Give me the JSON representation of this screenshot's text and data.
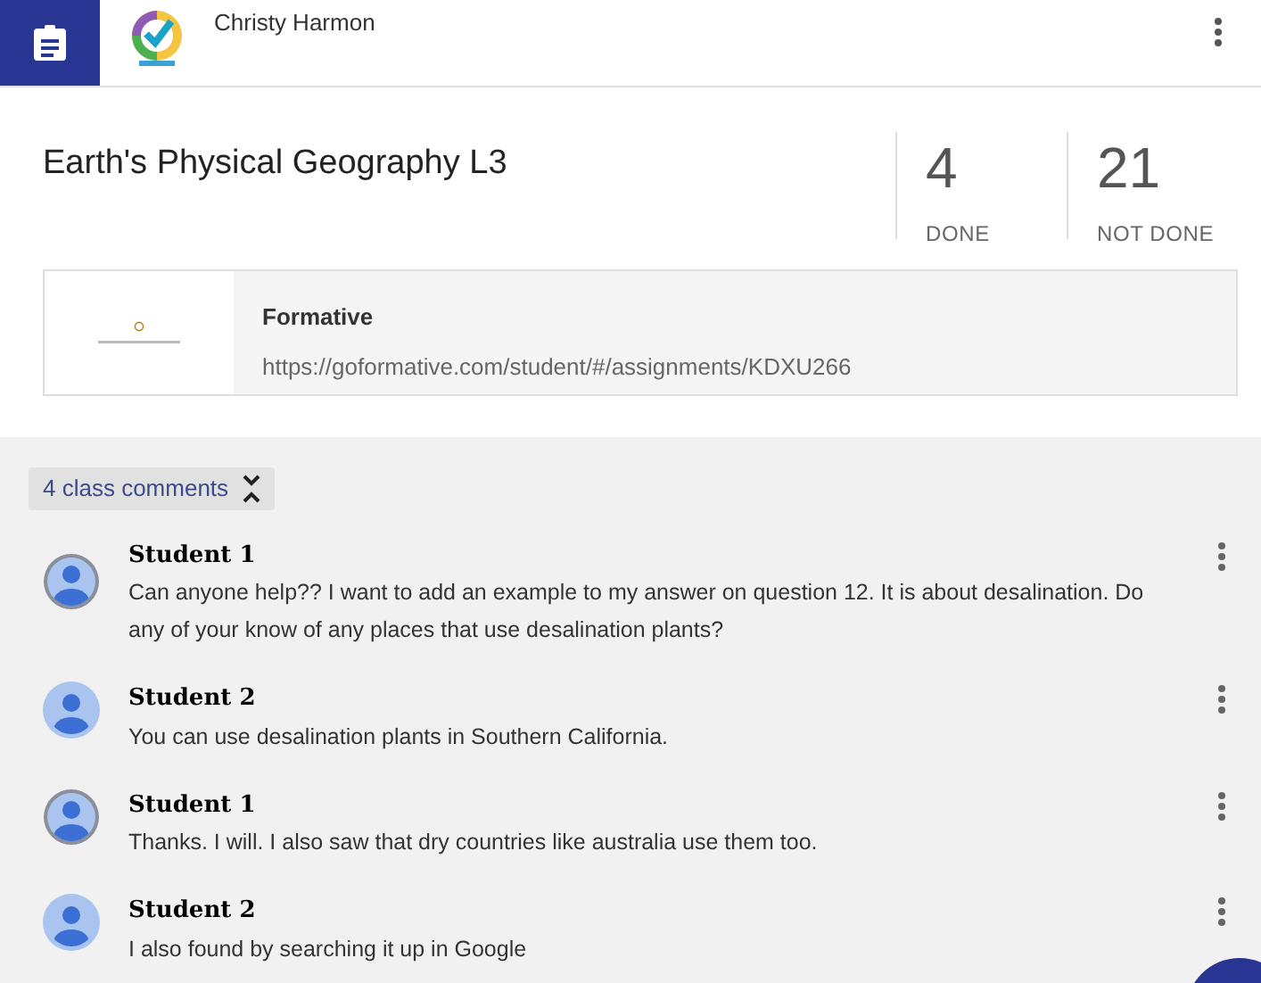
{
  "header": {
    "user_name": "Christy Harmon"
  },
  "assignment": {
    "title": "Earth's Physical Geography L3",
    "stats": [
      {
        "count": "4",
        "label": "DONE"
      },
      {
        "count": "21",
        "label": "NOT DONE"
      }
    ]
  },
  "attachment": {
    "title": "Formative",
    "url": "https://goformative.com/student/#/assignments/KDXU266"
  },
  "comments_toggle": {
    "label": "4 class comments",
    "expanded": true
  },
  "comments": [
    {
      "author": "Student 1",
      "text": "Can anyone help?? I want to add an example to my answer on question 12. It is about desalination. Do any of your know of any places that use desalination plants?",
      "ringed": true
    },
    {
      "author": "Student 2",
      "text": "You can use desalination plants in Southern California.",
      "ringed": false
    },
    {
      "author": "Student 1",
      "text": "Thanks. I will. I also saw that dry countries like australia use them too.",
      "ringed": true
    },
    {
      "author": "Student 2",
      "text": "I also found by searching it up in Google",
      "ringed": false
    }
  ]
}
